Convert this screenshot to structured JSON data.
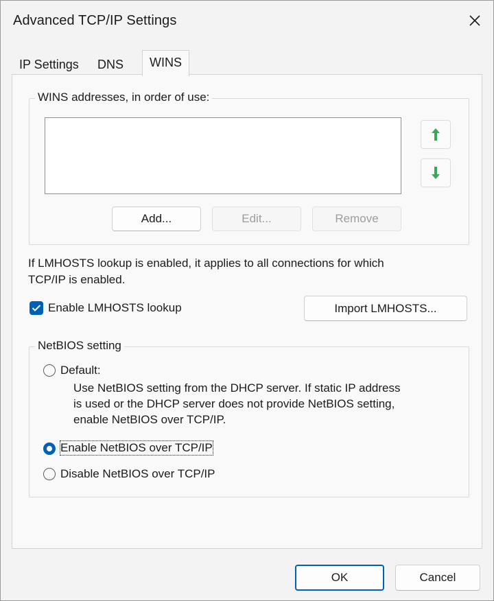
{
  "window": {
    "title": "Advanced TCP/IP Settings",
    "close_icon": "close-icon"
  },
  "tabs": [
    {
      "label": "IP Settings",
      "active": false
    },
    {
      "label": "DNS",
      "active": false
    },
    {
      "label": "WINS",
      "active": true
    }
  ],
  "wins": {
    "group_label": "WINS addresses, in order of use:",
    "addresses": [],
    "move_up_icon": "arrow-up-icon",
    "move_down_icon": "arrow-down-icon",
    "add_label": "Add...",
    "edit_label": "Edit...",
    "remove_label": "Remove",
    "edit_enabled": false,
    "remove_enabled": false
  },
  "lmhosts": {
    "info_line1": "If LMHOSTS lookup is enabled, it applies to all connections for which",
    "info_line2": "TCP/IP is enabled.",
    "enable_label": "Enable LMHOSTS lookup",
    "enable_checked": true,
    "import_label": "Import LMHOSTS..."
  },
  "netbios": {
    "group_label": "NetBIOS setting",
    "options": [
      {
        "label": "Default:",
        "checked": false
      },
      {
        "label": "Enable NetBIOS over TCP/IP",
        "checked": true
      },
      {
        "label": "Disable NetBIOS over TCP/IP",
        "checked": false
      }
    ],
    "default_desc_line1": "Use NetBIOS setting from the DHCP server. If static IP address",
    "default_desc_line2": "is used or the DHCP server does not provide NetBIOS setting,",
    "default_desc_line3": "enable NetBIOS over TCP/IP."
  },
  "footer": {
    "ok_label": "OK",
    "cancel_label": "Cancel"
  },
  "colors": {
    "accent": "#005fb8",
    "arrow_green": "#3aa757"
  }
}
